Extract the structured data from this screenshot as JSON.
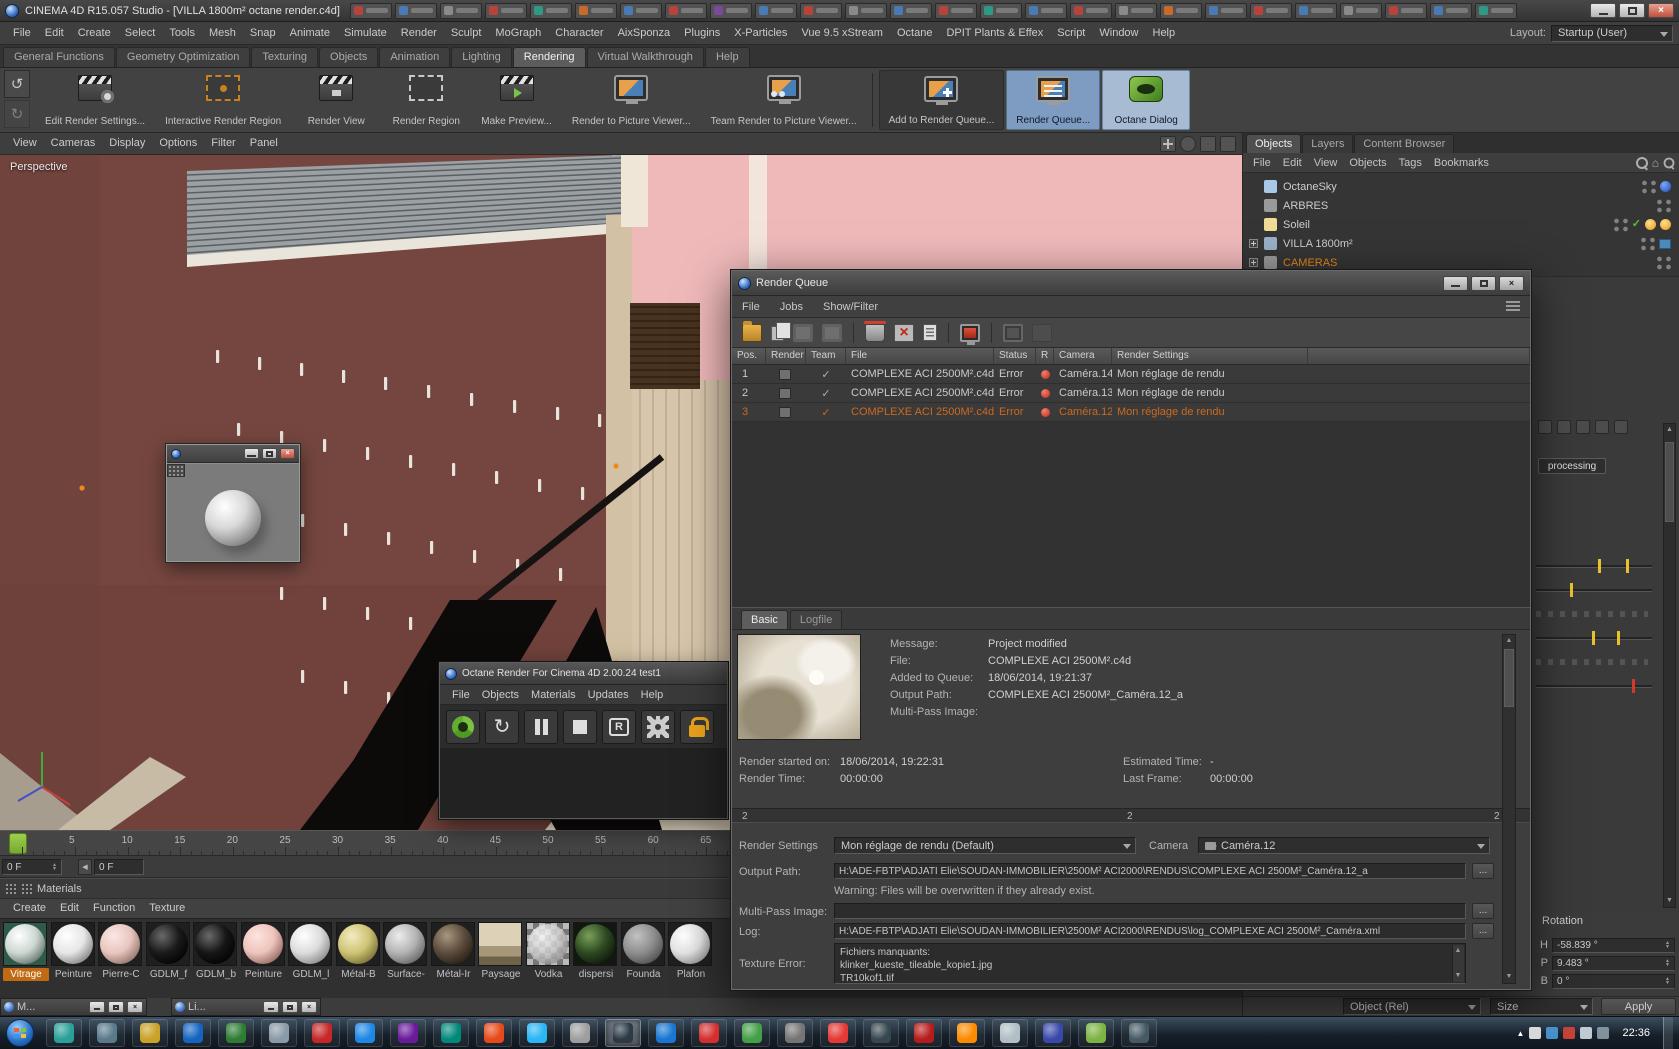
{
  "titlebar": {
    "title": "CINEMA 4D R15.057 Studio - [VILLA 1800m² octane render.c4d]",
    "tab_colors": [
      "#b8433a",
      "#4a7ab5",
      "#8a8a8a",
      "#b8433a",
      "#2e9a86",
      "#c86a2a",
      "#4a7ab5",
      "#b8433a",
      "#7a4a9a",
      "#4a7ab5",
      "#b8433a",
      "#8a8a8a",
      "#4a7ab5",
      "#b8433a",
      "#2e9a86",
      "#4a7ab5",
      "#b8433a",
      "#8a8a8a",
      "#c86a2a",
      "#4a7ab5",
      "#b8433a",
      "#4a7ab5",
      "#8a8a8a",
      "#b8433a",
      "#4a7ab5",
      "#2e9a86"
    ]
  },
  "menubar": {
    "items": [
      "File",
      "Edit",
      "Create",
      "Select",
      "Tools",
      "Mesh",
      "Snap",
      "Animate",
      "Simulate",
      "Render",
      "Sculpt",
      "MoGraph",
      "Character",
      "AixSponza",
      "Plugins",
      "X-Particles",
      "Vue 9.5 xStream",
      "Octane",
      "DPIT Plants & Effex",
      "Script",
      "Window",
      "Help"
    ],
    "layout_label": "Layout:",
    "layout_value": "Startup (User)"
  },
  "palette_tabs": {
    "items": [
      "General Functions",
      "Geometry Optimization",
      "Texturing",
      "Objects",
      "Animation",
      "Lighting",
      "Rendering",
      "Virtual Walkthrough",
      "Help"
    ],
    "active": "Rendering"
  },
  "toolbar": {
    "buttons": [
      {
        "label": "Edit Render Settings...",
        "icon": "render-settings"
      },
      {
        "label": "Interactive Render Region",
        "icon": "interactive-region"
      },
      {
        "label": "Render View",
        "icon": "render-view"
      },
      {
        "label": "Render Region",
        "icon": "render-region"
      },
      {
        "label": "Make Preview...",
        "icon": "make-preview"
      },
      {
        "label": "Render to Picture Viewer...",
        "icon": "picture-viewer"
      },
      {
        "label": "Team Render to Picture Viewer...",
        "icon": "team-render"
      },
      {
        "sep": true
      },
      {
        "label": "Add to Render Queue...",
        "icon": "add-queue",
        "state": "grouped"
      },
      {
        "label": "Render Queue...",
        "icon": "render-queue",
        "state": "selected"
      },
      {
        "label": "Octane Dialog",
        "icon": "octane",
        "state": "selected2"
      }
    ]
  },
  "viewport": {
    "menu": [
      "View",
      "Cameras",
      "Display",
      "Options",
      "Filter",
      "Panel"
    ],
    "label": "Perspective"
  },
  "objects_panel": {
    "tabs": [
      "Objects",
      "Layers",
      "Content Browser"
    ],
    "active_tab": "Objects",
    "menu": [
      "File",
      "Edit",
      "View",
      "Objects",
      "Tags",
      "Bookmarks"
    ],
    "tree": [
      {
        "label": "OctaneSky",
        "tag": "sky"
      },
      {
        "label": "ARBRES",
        "tag": "plain"
      },
      {
        "label": "Soleil",
        "tag": "sun"
      },
      {
        "label": "VILLA 1800m²",
        "tag": "display",
        "expander": true
      },
      {
        "label": "CAMERAS",
        "tag": "plain",
        "expander": true,
        "selected": true
      }
    ]
  },
  "right_panel": {
    "processing_label": "processing"
  },
  "coordinates": {
    "title": "Rotation",
    "rows": [
      {
        "label": "H",
        "value": "-58.839 °"
      },
      {
        "label": "P",
        "value": "9.483 °"
      },
      {
        "label": "B",
        "value": "0 °"
      }
    ],
    "object_mode": "Object (Rel)",
    "size_mode": "Size",
    "apply_label": "Apply"
  },
  "render_queue": {
    "title": "Render Queue",
    "menu": [
      "File",
      "Jobs",
      "Show/Filter"
    ],
    "columns": [
      "Pos.",
      "Render",
      "Team",
      "File",
      "Status",
      "R",
      "Camera",
      "Render Settings"
    ],
    "rows": [
      {
        "pos": "1",
        "file": "COMPLEXE ACI 2500M².c4d",
        "status": "Error",
        "camera": "Caméra.14",
        "settings": "Mon réglage de rendu",
        "selected": false
      },
      {
        "pos": "2",
        "file": "COMPLEXE ACI 2500M².c4d",
        "status": "Error",
        "camera": "Caméra.13",
        "settings": "Mon réglage de rendu",
        "selected": false
      },
      {
        "pos": "3",
        "file": "COMPLEXE ACI 2500M².c4d",
        "status": "Error",
        "camera": "Caméra.12",
        "settings": "Mon réglage de rendu",
        "selected": true
      }
    ],
    "tabs": [
      "Basic",
      "Logfile"
    ],
    "active_tab": "Basic",
    "details": [
      {
        "label": "Message:",
        "value": "Project modified"
      },
      {
        "label": "File:",
        "value": "COMPLEXE ACI 2500M².c4d"
      },
      {
        "label": "Added to Queue:",
        "value": "18/06/2014, 19:21:37"
      },
      {
        "label": "Output Path:",
        "value": "COMPLEXE ACI 2500M²_Caméra.12_a"
      },
      {
        "label": "Multi-Pass Image:",
        "value": ""
      }
    ],
    "stats": {
      "started_label": "Render started on:",
      "started_value": "18/06/2014, 19:22:31",
      "estimated_label": "Estimated Time:",
      "estimated_value": "-",
      "rtime_label": "Render Time:",
      "rtime_value": "00:00:00",
      "lastframe_label": "Last Frame:",
      "lastframe_value": "00:00:00"
    },
    "progress": {
      "left": "2",
      "center": "2",
      "right": "2"
    },
    "settings_label": "Render Settings",
    "settings_value": "Mon réglage de rendu (Default)",
    "camera_label": "Camera",
    "camera_value": "Caméra.12",
    "output_path_label": "Output Path:",
    "output_path_value": "H:\\ADE-FBTP\\ADJATI Elie\\SOUDAN-IMMOBILIER\\2500M² ACI2000\\RENDUS\\COMPLEXE ACI 2500M²_Caméra.12_a",
    "warning": "Warning: Files will be overwritten if they already exist.",
    "multipass_label": "Multi-Pass Image:",
    "multipass_value": "",
    "log_label": "Log:",
    "log_value": "H:\\ADE-FBTP\\ADJATI Elie\\SOUDAN-IMMOBILIER\\2500M² ACI2000\\RENDUS\\log_COMPLEXE ACI 2500M²_Caméra.xml",
    "texture_error_label": "Texture Error:",
    "texture_lines": [
      "Fichiers manquants:",
      "klinker_kueste_tileable_kopie1.jpg",
      "TR10kof1.tif"
    ],
    "more_label": "..."
  },
  "octane_window": {
    "title": "Octane Render For Cinema 4D 2.00.24 test1",
    "menu": [
      "File",
      "Objects",
      "Materials",
      "Updates",
      "Help"
    ]
  },
  "timeline": {
    "numbers": [
      "5",
      "10",
      "15",
      "20",
      "25",
      "30",
      "35",
      "40",
      "45",
      "50",
      "55",
      "60",
      "65"
    ],
    "frame_a": "0 F",
    "frame_b": "0 F"
  },
  "materials_panel": {
    "title": "Materials",
    "menu": [
      "Create",
      "Edit",
      "Function",
      "Texture"
    ],
    "items": [
      {
        "label": "Vitrage",
        "style": "sphere",
        "bg": "#2e5a4a",
        "hi": "#ffffff",
        "mid": "#cdd8d2",
        "lo": "#5a6a62",
        "selected": true
      },
      {
        "label": "Peinture",
        "style": "sphere",
        "bg": "#1f1f1f",
        "hi": "#ffffff",
        "mid": "#e6e6e6",
        "lo": "#7a7a7a"
      },
      {
        "label": "Pierre-C",
        "style": "sphere",
        "bg": "#1f1f1f",
        "hi": "#fae8e4",
        "mid": "#e8c6be",
        "lo": "#8a6a60"
      },
      {
        "label": "GDLM_f",
        "style": "sphere",
        "bg": "#1f1f1f",
        "hi": "#6a6a6a",
        "mid": "#1a1a1a",
        "lo": "#000000"
      },
      {
        "label": "GDLM_b",
        "style": "sphere",
        "bg": "#1f1f1f",
        "hi": "#6a6a6a",
        "mid": "#161616",
        "lo": "#000000"
      },
      {
        "label": "Peinture",
        "style": "sphere",
        "bg": "#1f1f1f",
        "hi": "#fbe4de",
        "mid": "#eec4bc",
        "lo": "#8a625a"
      },
      {
        "label": "GDLM_l",
        "style": "sphere",
        "bg": "#1f1f1f",
        "hi": "#ffffff",
        "mid": "#dcdcdc",
        "lo": "#828282"
      },
      {
        "label": "Métal-B",
        "style": "sphere",
        "bg": "#1f1f1f",
        "hi": "#f2ecc2",
        "mid": "#cfc374",
        "lo": "#6e6530"
      },
      {
        "label": "Surface-",
        "style": "sphere",
        "bg": "#1f1f1f",
        "hi": "#ececec",
        "mid": "#b4b4b4",
        "lo": "#5e5e5e"
      },
      {
        "label": "Métal-Ir",
        "style": "sphere",
        "bg": "#1f1f1f",
        "hi": "#a89681",
        "mid": "#5c4c3c",
        "lo": "#241c12"
      },
      {
        "label": "Paysage",
        "style": "flat",
        "bg": "#c8baa0",
        "hi": "#ddd2b8",
        "mid": "#a6977a",
        "lo": "#6e6248"
      },
      {
        "label": "Vodka",
        "style": "checker",
        "bg": "#9a9a9a",
        "hi": "#ffffff",
        "mid": "#d0d0d0",
        "lo": "#808080"
      },
      {
        "label": "dispersi",
        "style": "sphere",
        "bg": "#101810",
        "hi": "#7aa05a",
        "mid": "#2e4a22",
        "lo": "#0c140a"
      },
      {
        "label": "Founda",
        "style": "sphere",
        "bg": "#1f1f1f",
        "hi": "#c2c2c2",
        "mid": "#8e8e8e",
        "lo": "#4a4a4a"
      },
      {
        "label": "Plafon",
        "style": "sphere",
        "bg": "#1f1f1f",
        "hi": "#ffffff",
        "mid": "#e2e2e2",
        "lo": "#8a8a8a"
      }
    ]
  },
  "minimized_windows": [
    {
      "label": "M..."
    },
    {
      "label": "Li..."
    }
  ],
  "taskbar": {
    "time": "22:36",
    "icon_colors": [
      "#2aa198",
      "#5a7a8a",
      "#c9a227",
      "#1565c0",
      "#2e7d32",
      "#8a9aa6",
      "#c62828",
      "#1e88e5",
      "#6a1b9a",
      "#00897b",
      "#e64a19",
      "#29b6f6",
      "#9e9e9e",
      "#2b3a46",
      "#1976d2",
      "#d32f2f",
      "#43a047",
      "#757575",
      "#e53935",
      "#37474f",
      "#b71c1c",
      "#fb8c00",
      "#b0bec5",
      "#3949ab",
      "#7cb342",
      "#455a64"
    ],
    "pressed_index": 13
  }
}
